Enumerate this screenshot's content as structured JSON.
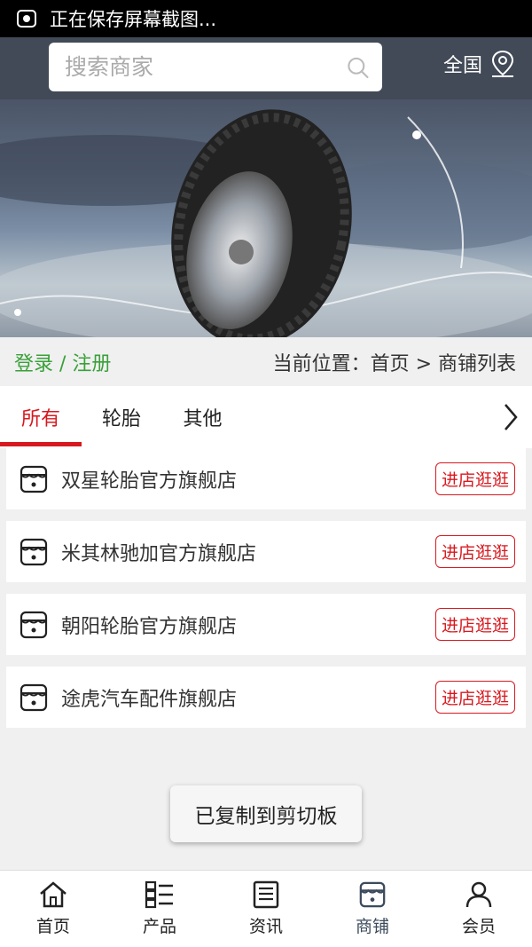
{
  "status_bar": {
    "text": "正在保存屏幕截图..."
  },
  "header": {
    "search_placeholder": "搜索商家",
    "region_label": "全国"
  },
  "crumbbar": {
    "login_register": "登录 / 注册",
    "location": "当前位置：首页 > 商铺列表"
  },
  "tabs": [
    {
      "label": "所有",
      "active": true
    },
    {
      "label": "轮胎",
      "active": false
    },
    {
      "label": "其他",
      "active": false
    }
  ],
  "shops": [
    {
      "name": "双星轮胎官方旗舰店",
      "button": "进店逛逛"
    },
    {
      "name": "米其林驰加官方旗舰店",
      "button": "进店逛逛"
    },
    {
      "name": "朝阳轮胎官方旗舰店",
      "button": "进店逛逛"
    },
    {
      "name": "途虎汽车配件旗舰店",
      "button": "进店逛逛"
    }
  ],
  "toast": "已复制到剪切板",
  "bottom_nav": [
    {
      "label": "首页",
      "icon": "home-icon"
    },
    {
      "label": "产品",
      "icon": "grid-list-icon"
    },
    {
      "label": "资讯",
      "icon": "news-icon"
    },
    {
      "label": "商铺",
      "icon": "store-icon",
      "active": true
    },
    {
      "label": "会员",
      "icon": "user-icon"
    }
  ],
  "colors": {
    "accent": "#d7191f",
    "header": "#424a57",
    "login": "#3aa13a"
  }
}
